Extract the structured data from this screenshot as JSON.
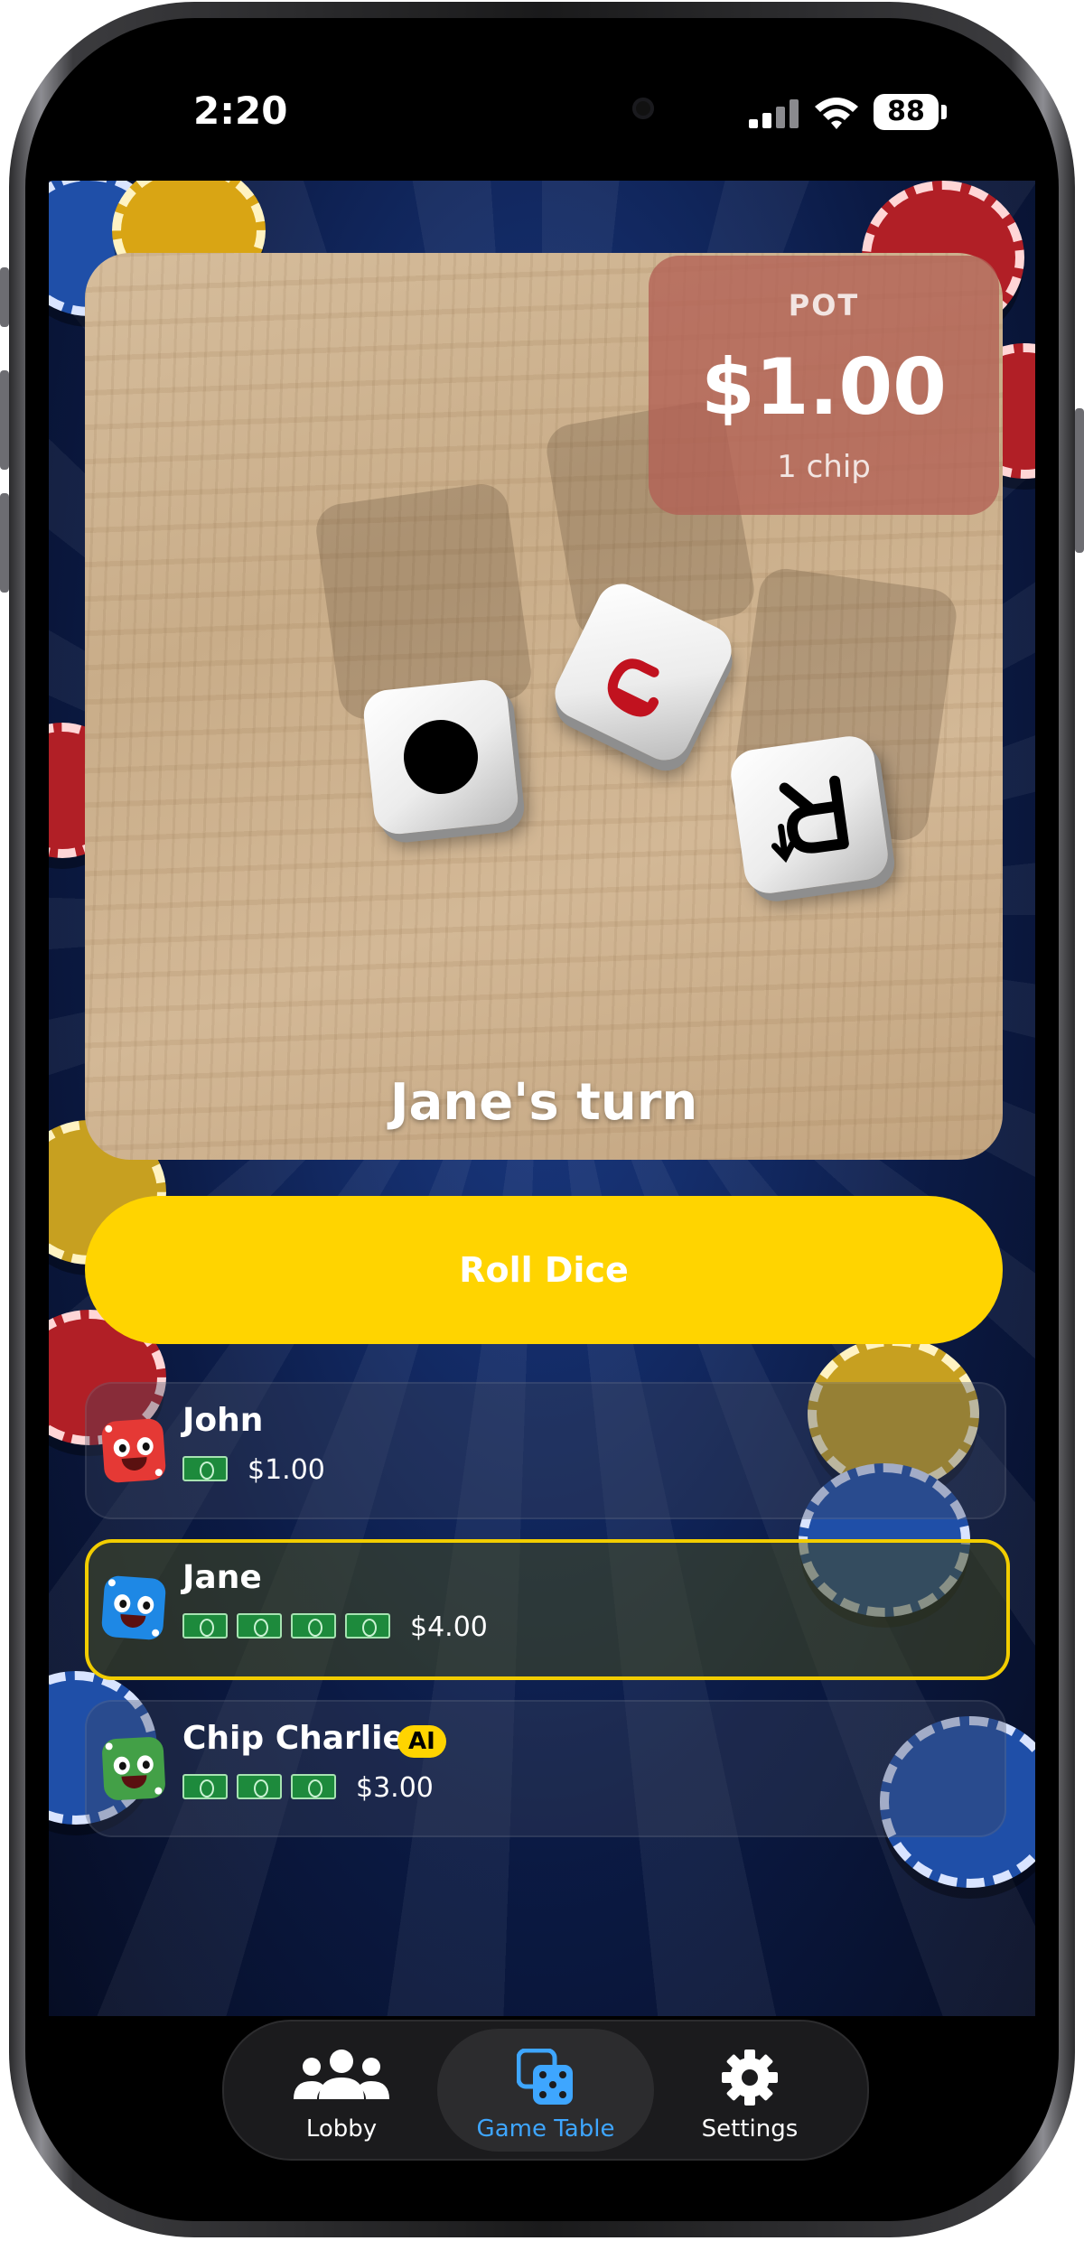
{
  "status_bar": {
    "time": "2:20",
    "battery": "88"
  },
  "pot": {
    "label": "POT",
    "amount": "$1.00",
    "chips": "1 chip"
  },
  "table": {
    "turn_text": "Jane's turn"
  },
  "roll_button": {
    "label": "Roll Dice"
  },
  "players": [
    {
      "name": "John",
      "money": "$1.00",
      "bills": 1,
      "ai": false,
      "active": false,
      "die_color": "#e53935"
    },
    {
      "name": "Jane",
      "money": "$4.00",
      "bills": 4,
      "ai": false,
      "active": true,
      "die_color": "#1e88e5"
    },
    {
      "name": "Chip Charlie",
      "money": "$3.00",
      "bills": 3,
      "ai": true,
      "ai_label": "AI",
      "active": false,
      "die_color": "#43a047"
    }
  ],
  "tabbar": {
    "tabs": [
      {
        "label": "Lobby",
        "icon": "people-icon",
        "selected": false
      },
      {
        "label": "Game Table",
        "icon": "dice-icon",
        "selected": true
      },
      {
        "label": "Settings",
        "icon": "gear-icon",
        "selected": false
      }
    ]
  },
  "colors": {
    "accent": "#ffd400",
    "tab_selected": "#3ea6ff",
    "pot_bg": "#b26054"
  }
}
